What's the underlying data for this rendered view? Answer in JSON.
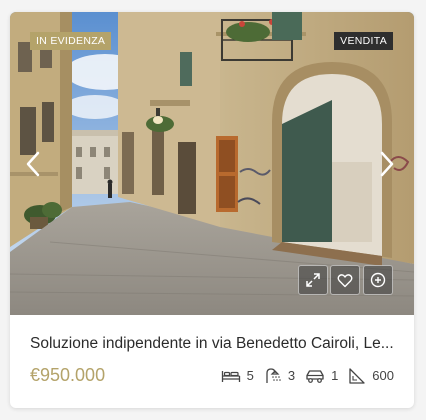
{
  "listing": {
    "badge_featured": "IN EVIDENZA",
    "badge_status": "VENDITA",
    "title": "Soluzione indipendente in via Benedetto Cairoli, Le...",
    "price": "€950.000",
    "features": {
      "bedrooms": "5",
      "bathrooms": "3",
      "garages": "1",
      "area": "600"
    }
  },
  "icons": {
    "prev": "chevron-left-icon",
    "next": "chevron-right-icon",
    "expand": "expand-icon",
    "favorite": "heart-icon",
    "add": "plus-circle-icon",
    "bed": "bed-icon",
    "bath": "shower-icon",
    "garage": "car-icon",
    "area": "area-icon"
  },
  "colors": {
    "accent": "#b4a36a",
    "dark_badge": "#2e2e2e",
    "text": "#2b2b2b"
  }
}
